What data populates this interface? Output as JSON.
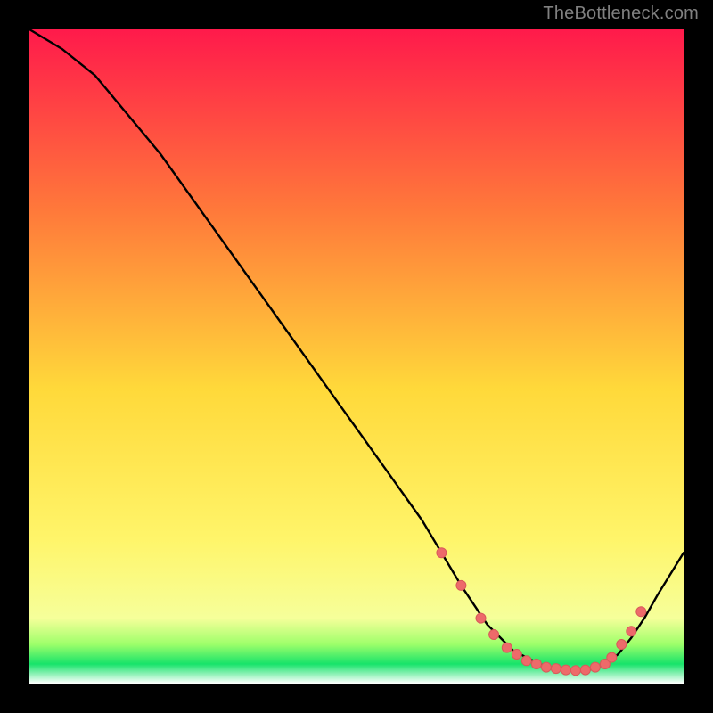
{
  "watermark": "TheBottleneck.com",
  "colors": {
    "frame": "#000000",
    "curve": "#000000",
    "marker_fill": "#ed6a6a",
    "marker_stroke": "#d85a5a",
    "gradient_top": "#ff1a4b",
    "gradient_mid_upper": "#ff7a3a",
    "gradient_mid": "#ffd93a",
    "gradient_mid_lower": "#fff56a",
    "gradient_low": "#f6ff9a",
    "gradient_green1": "#9dff6a",
    "gradient_green2": "#17e36a",
    "gradient_bottom_white": "#ffffff"
  },
  "chart_data": {
    "type": "line",
    "title": "",
    "xlabel": "",
    "ylabel": "",
    "xlim": [
      0,
      100
    ],
    "ylim": [
      0,
      100
    ],
    "grid": false,
    "legend": false,
    "x": [
      0,
      5,
      10,
      15,
      20,
      25,
      30,
      35,
      40,
      45,
      50,
      55,
      60,
      63,
      66,
      68,
      70,
      72,
      74,
      76,
      78,
      80,
      82,
      84,
      86,
      88,
      90,
      92,
      94,
      96,
      100
    ],
    "values": [
      100,
      97,
      93,
      87,
      81,
      74,
      67,
      60,
      53,
      46,
      39,
      32,
      25,
      20,
      15,
      12,
      9,
      7,
      5,
      4,
      3,
      2.2,
      2,
      2,
      2.2,
      3,
      4.5,
      7,
      10,
      13.5,
      20
    ],
    "markers_x": [
      63,
      66,
      69,
      71,
      73,
      74.5,
      76,
      77.5,
      79,
      80.5,
      82,
      83.5,
      85,
      86.5,
      88,
      89,
      90.5,
      92,
      93.5
    ],
    "markers_y": [
      20,
      15,
      10,
      7.5,
      5.5,
      4.5,
      3.5,
      3,
      2.5,
      2.3,
      2.1,
      2.0,
      2.1,
      2.5,
      3,
      4,
      6,
      8,
      11
    ]
  }
}
